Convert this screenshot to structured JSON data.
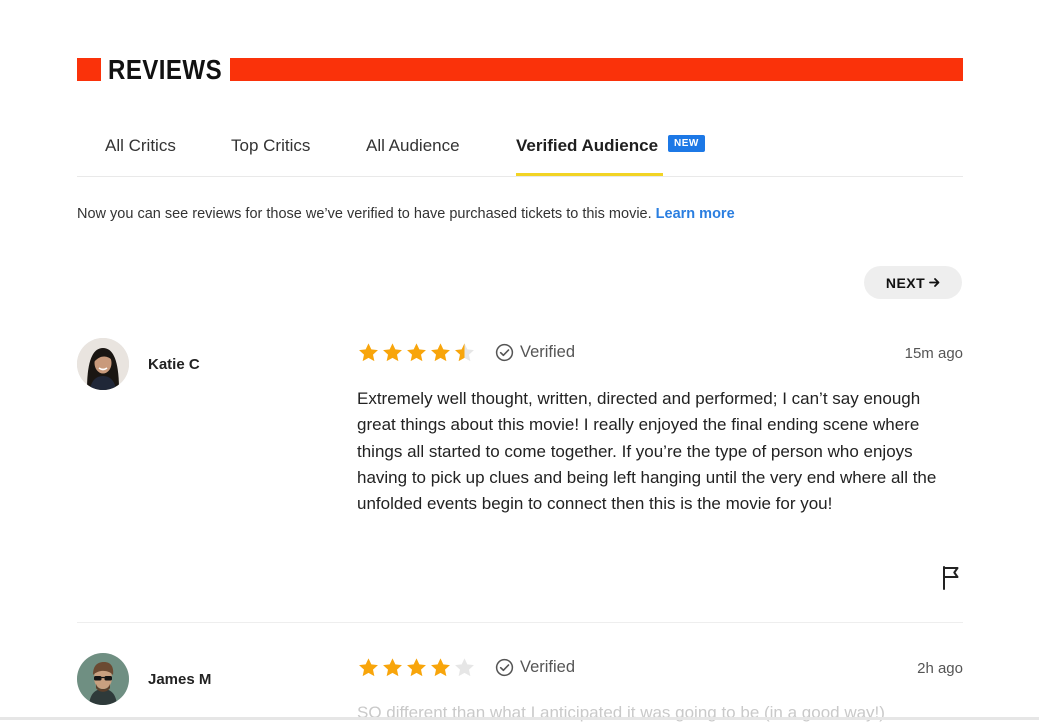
{
  "header": {
    "title": "REVIEWS",
    "accent_color": "#fa320a"
  },
  "tabs": [
    {
      "label": "All Critics",
      "active": false
    },
    {
      "label": "Top Critics",
      "active": false
    },
    {
      "label": "All Audience",
      "active": false
    },
    {
      "label": "Verified Audience",
      "active": true,
      "badge": "NEW"
    }
  ],
  "info": {
    "text": "Now you can see reviews for those we’ve verified to have purchased tickets to this movie. ",
    "link": "Learn more"
  },
  "pagination": {
    "next_label": "NEXT"
  },
  "reviews": [
    {
      "name": "Katie C",
      "rating": 4.5,
      "verified_label": "Verified",
      "time": "15m ago",
      "text": "Extremely well thought, written, directed and performed; I can’t say enough great things about this movie! I really enjoyed the final ending scene where things all started to come together. If you’re the type of person who enjoys having to pick up clues and being left hanging until the very end where all the unfolded events begin to connect then this is the movie for you!",
      "avatar_icon": "user-avatar-icon"
    },
    {
      "name": "James M",
      "rating": 4,
      "verified_label": "Verified",
      "time": "2h ago",
      "text": "SO different than what I anticipated it was going to be (in a good way!)",
      "avatar_icon": "user-avatar-icon"
    }
  ],
  "colors": {
    "star": "#f8a50b",
    "star_empty": "#e6e6e6",
    "link": "#2a7ee0",
    "badge": "#1c78e6",
    "tab_underline": "#f2d424"
  }
}
